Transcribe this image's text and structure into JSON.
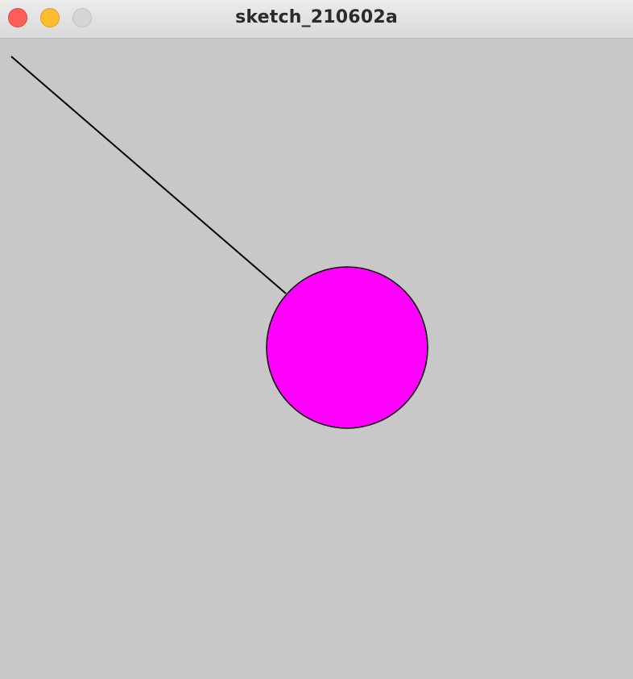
{
  "window": {
    "title": "sketch_210602a",
    "buttons": {
      "close": {
        "color": "#ff5f57",
        "border": "#e0443e"
      },
      "minimize": {
        "color": "#febc2e",
        "border": "#dea123"
      },
      "zoom": {
        "color": "#d6d6d6",
        "border": "#c2c2c2"
      }
    }
  },
  "sketch": {
    "background": "#c8c8c8",
    "ball": {
      "fill": "#ff00ff",
      "stroke": "#000000"
    },
    "string": {
      "stroke": "#000000"
    }
  }
}
